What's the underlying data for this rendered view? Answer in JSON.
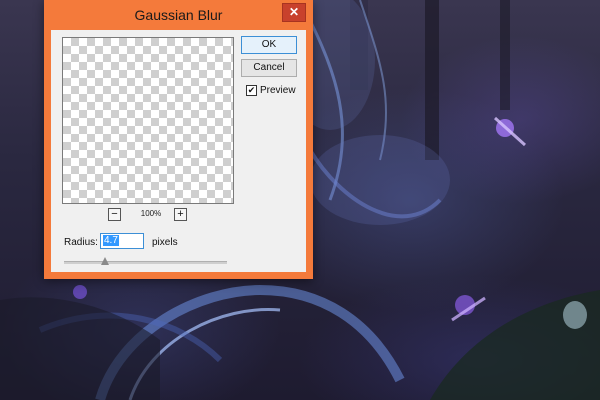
{
  "dialog": {
    "title": "Gaussian Blur",
    "close_label": "✕",
    "ok_label": "OK",
    "cancel_label": "Cancel",
    "preview_label": "Preview",
    "preview_checked": true,
    "zoom": {
      "minus_label": "−",
      "plus_label": "+",
      "level": "100%"
    },
    "radius": {
      "label": "Radius:",
      "value": "4.7",
      "unit": "pixels"
    },
    "slider_value_fraction": 0.25
  },
  "colors": {
    "dialog_frame": "#f47a3b",
    "close_button": "#c8412c",
    "focus_blue": "#3c8fd6"
  }
}
